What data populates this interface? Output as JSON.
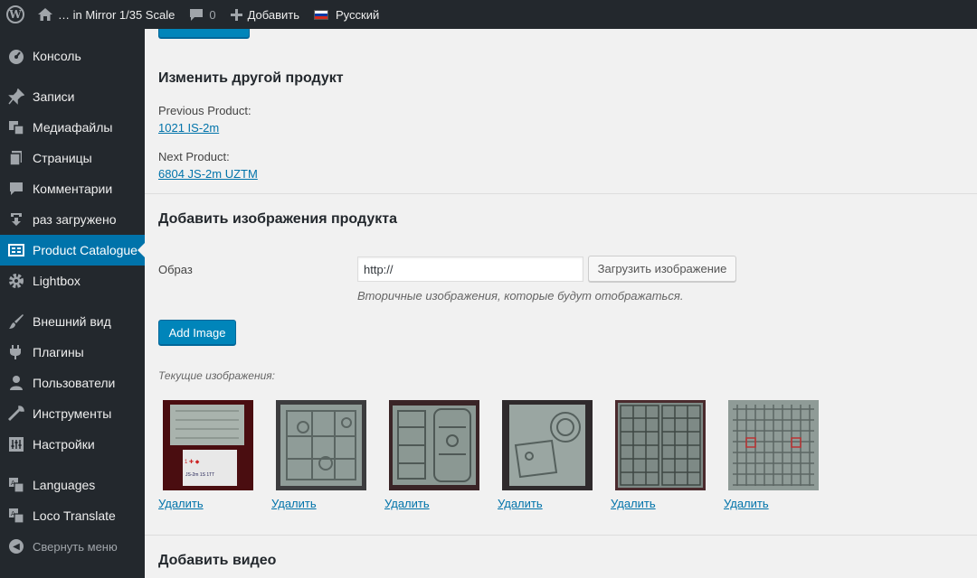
{
  "admin_bar": {
    "site_name": "… in Mirror 1/35 Scale",
    "comments_count": "0",
    "add_label": "Добавить",
    "language_label": "Русский"
  },
  "sidebar": {
    "items": [
      {
        "label": "Консоль",
        "icon": "dashboard-icon"
      },
      {
        "label": "Записи",
        "icon": "pin-icon"
      },
      {
        "label": "Медиафайлы",
        "icon": "media-icon"
      },
      {
        "label": "Страницы",
        "icon": "pages-icon"
      },
      {
        "label": "Комментарии",
        "icon": "comments-icon"
      },
      {
        "label": "раз загружено",
        "icon": "download-icon"
      },
      {
        "label": "Product Catalogue",
        "icon": "catalogue-icon"
      },
      {
        "label": "Lightbox",
        "icon": "gear-icon"
      },
      {
        "label": "Внешний вид",
        "icon": "brush-icon"
      },
      {
        "label": "Плагины",
        "icon": "plugin-icon"
      },
      {
        "label": "Пользователи",
        "icon": "users-icon"
      },
      {
        "label": "Инструменты",
        "icon": "wrench-icon"
      },
      {
        "label": "Настройки",
        "icon": "settings-icon"
      },
      {
        "label": "Languages",
        "icon": "translate-icon"
      },
      {
        "label": "Loco Translate",
        "icon": "translate-icon"
      },
      {
        "label": "Свернуть меню",
        "icon": "collapse-icon"
      }
    ],
    "current": "Product Catalogue"
  },
  "edit_other": {
    "title": "Изменить другой продукт",
    "previous_label": "Previous Product:",
    "previous_link": "1021 IS-2m",
    "next_label": "Next Product:",
    "next_link": "6804 JS-2m UZTM"
  },
  "add_images": {
    "title": "Добавить изображения продукта",
    "field_label": "Образ",
    "input_value": "http://",
    "upload_button": "Загрузить изображение",
    "description": "Вторичные изображения, которые будут отображаться.",
    "add_button": "Add Image",
    "current_label": "Текущие изображения:",
    "delete_label": "Удалить",
    "image_count": 6
  },
  "add_video": {
    "title": "Добавить видео"
  },
  "colors": {
    "sidebar_bg": "#23282d",
    "accent": "#0073aa",
    "button_primary": "#0085ba",
    "content_bg": "#f1f1f1"
  }
}
